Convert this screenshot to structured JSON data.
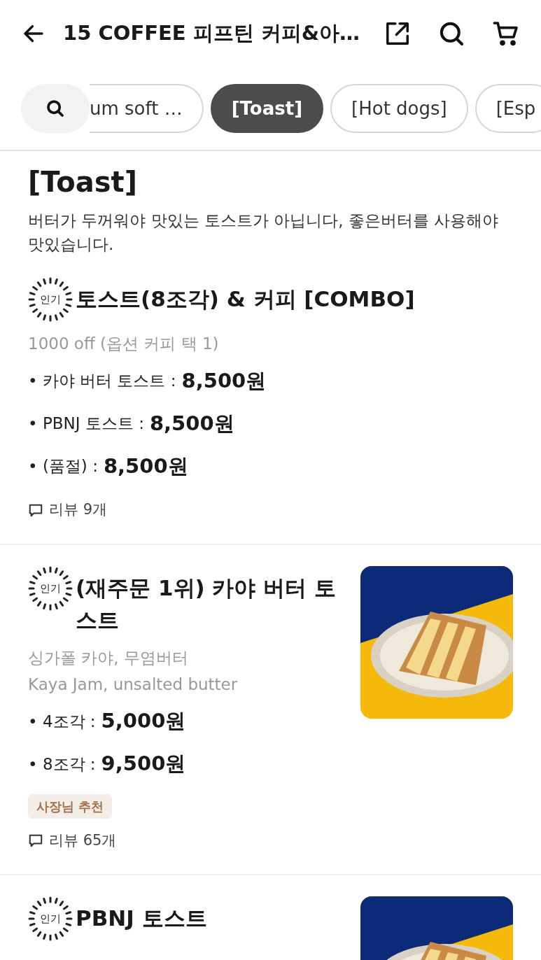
{
  "header": {
    "title": "15 COFFEE 피프틴 커피&아…"
  },
  "categories": [
    {
      "label": "um soft …",
      "selected": false
    },
    {
      "label": "[Toast]",
      "selected": true
    },
    {
      "label": "[Hot dogs]",
      "selected": false
    },
    {
      "label": "[Esp",
      "selected": false
    }
  ],
  "section": {
    "title": "[Toast]",
    "description": "버터가 두꺼워야 맛있는 토스트가 아닙니다, 좋은버터를 사용해야 맛있습니다."
  },
  "items": [
    {
      "badge": "인기",
      "title": "토스트(8조각) & 커피 [COMBO]",
      "subtitle": [
        "1000 off (옵션 커피 택 1)"
      ],
      "options": [
        {
          "label": "• 카야 버터 토스트 :",
          "price": "8,500원"
        },
        {
          "label": "• PBNJ 토스트 :",
          "price": "8,500원"
        },
        {
          "label": "• (품절) :",
          "price": "8,500원"
        }
      ],
      "reviews": "리뷰 9개"
    },
    {
      "badge": "인기",
      "title": "(재주문 1위) 카야 버터 토스트",
      "subtitle": [
        "싱가폴 카야, 무염버터",
        "Kaya Jam, unsalted butter"
      ],
      "options": [
        {
          "label": "• 4조각 :",
          "price": "5,000원"
        },
        {
          "label": "• 8조각 :",
          "price": "9,500원"
        }
      ],
      "tag": "사장님 추천",
      "reviews": "리뷰 65개",
      "image": {
        "kind": "picture"
      }
    },
    {
      "badge": "인기",
      "title": "PBNJ 토스트",
      "image": {
        "kind": "picture"
      }
    }
  ]
}
